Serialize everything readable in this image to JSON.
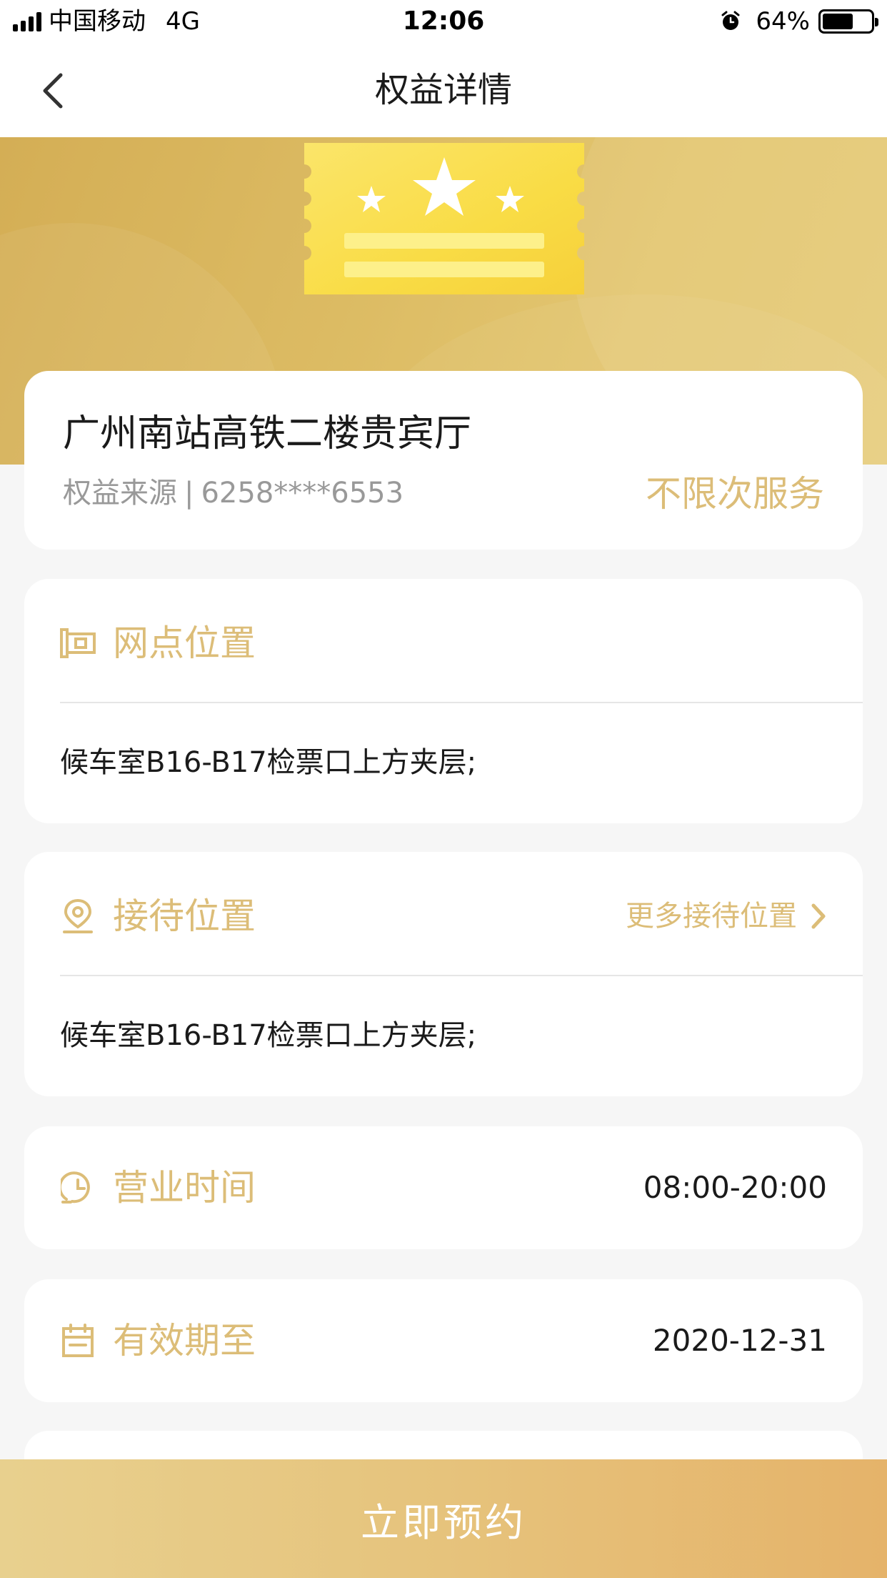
{
  "status_bar": {
    "carrier": "中国移动",
    "network": "4G",
    "time": "12:06",
    "battery_percent_text": "64%",
    "battery_level": 0.64
  },
  "nav": {
    "title": "权益详情",
    "back_icon": "chevron-left-icon"
  },
  "benefit": {
    "title": "广州南站高铁二楼贵宾厅",
    "source_label": "权益来源",
    "source_separator": "|",
    "source_card": "6258****6553",
    "usage_tag": "不限次服务"
  },
  "branch_location": {
    "icon": "building-icon",
    "label": "网点位置",
    "value": "候车室B16-B17检票口上方夹层;"
  },
  "reception_location": {
    "icon": "location-pin-icon",
    "label": "接待位置",
    "more_label": "更多接待位置",
    "value": "候车室B16-B17检票口上方夹层;"
  },
  "business_hours": {
    "icon": "clock-icon",
    "label": "营业时间",
    "value": "08:00-20:00"
  },
  "valid_until": {
    "icon": "calendar-icon",
    "label": "有效期至",
    "value": "2020-12-31"
  },
  "action": {
    "book_label": "立即预约"
  },
  "colors": {
    "accent_gold": "#dcbd78",
    "banner_gold": "#d9b55d",
    "ticket_yellow": "#f9dc45",
    "text_primary": "#1a1a1a",
    "text_secondary": "#999999",
    "background": "#f6f6f6"
  }
}
